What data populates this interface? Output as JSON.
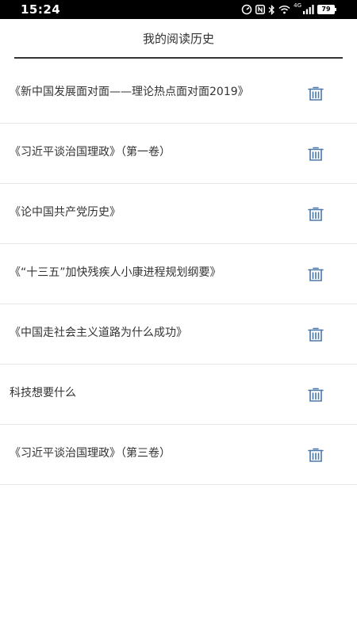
{
  "status_bar": {
    "time": "15:24",
    "network_label": "4G",
    "battery_level": "79",
    "icons": [
      "speedometer-icon",
      "nfc-icon",
      "bluetooth-icon",
      "wifi-icon",
      "cellular-signal-icon",
      "battery-icon"
    ]
  },
  "header": {
    "title": "我的阅读历史"
  },
  "history": {
    "delete_icon": "trash-icon",
    "accent_color": "#4a78a8",
    "items": [
      {
        "title": "《新中国发展面对面——理论热点面对面2019》"
      },
      {
        "title": "《习近平谈治国理政》（第一卷）"
      },
      {
        "title": "《论中国共产党历史》"
      },
      {
        "title": "《“十三五”加快残疾人小康进程规划纲要》"
      },
      {
        "title": "《中国走社会主义道路为什么成功》"
      },
      {
        "title": "科技想要什么"
      },
      {
        "title": "《习近平谈治国理政》（第三卷）"
      }
    ]
  }
}
